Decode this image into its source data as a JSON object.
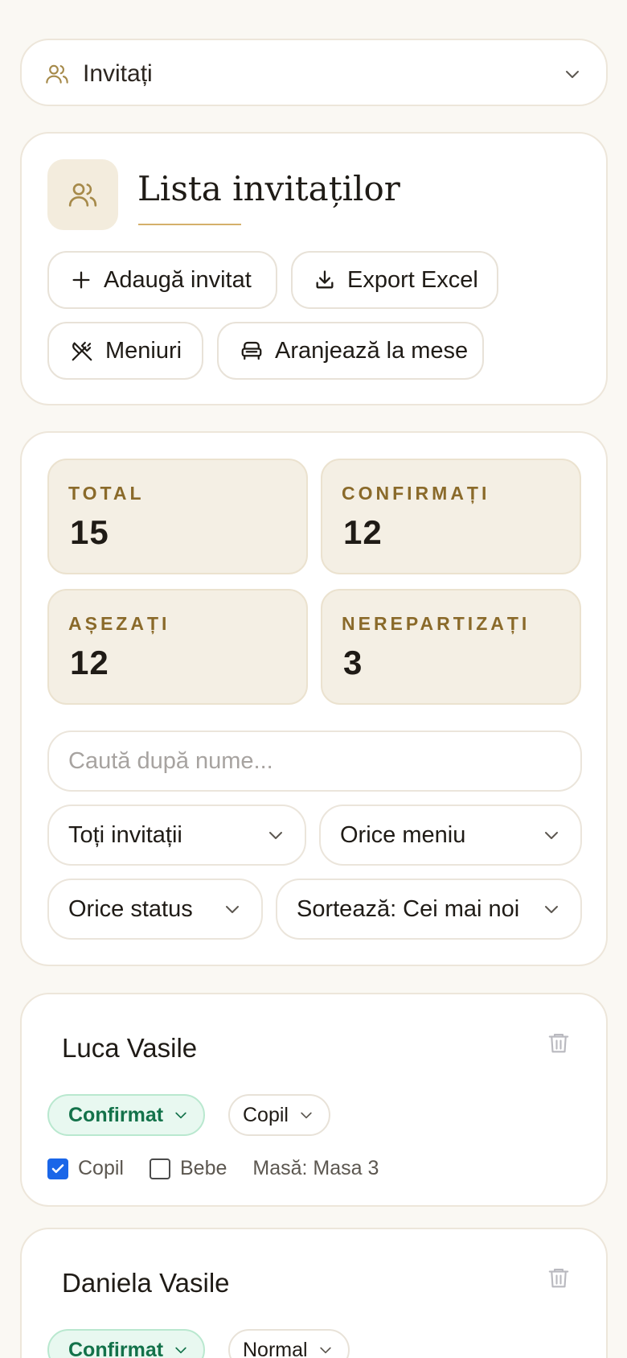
{
  "section": {
    "title": "Invitați"
  },
  "list": {
    "title": "Lista invitaților"
  },
  "actions": {
    "add_guest": "Adaugă invitat",
    "export_excel": "Export Excel",
    "menus": "Meniuri",
    "arrange_tables": "Aranjează la mese"
  },
  "stats": [
    {
      "label": "TOTAL",
      "value": "15"
    },
    {
      "label": "CONFIRMAȚI",
      "value": "12"
    },
    {
      "label": "AȘEZAȚI",
      "value": "12"
    },
    {
      "label": "NEREPARTIZAȚI",
      "value": "3"
    }
  ],
  "search": {
    "placeholder": "Caută după nume..."
  },
  "filters": {
    "guests": "Toți invitații",
    "menu": "Orice meniu",
    "status": "Orice status",
    "sort": "Sortează: Cei mai noi"
  },
  "guests": [
    {
      "name": "Luca Vasile",
      "status": "Confirmat",
      "type": "Copil",
      "child_label": "Copil",
      "child_checked": true,
      "baby_label": "Bebe",
      "baby_checked": false,
      "table": "Masă: Masa 3"
    },
    {
      "name": "Daniela Vasile",
      "status": "Confirmat",
      "type": "Normal"
    }
  ],
  "colors": {
    "accent": "#8a6a2a",
    "status_green": "#13724a",
    "checkbox_blue": "#1a66e8",
    "background": "#faf8f3"
  }
}
